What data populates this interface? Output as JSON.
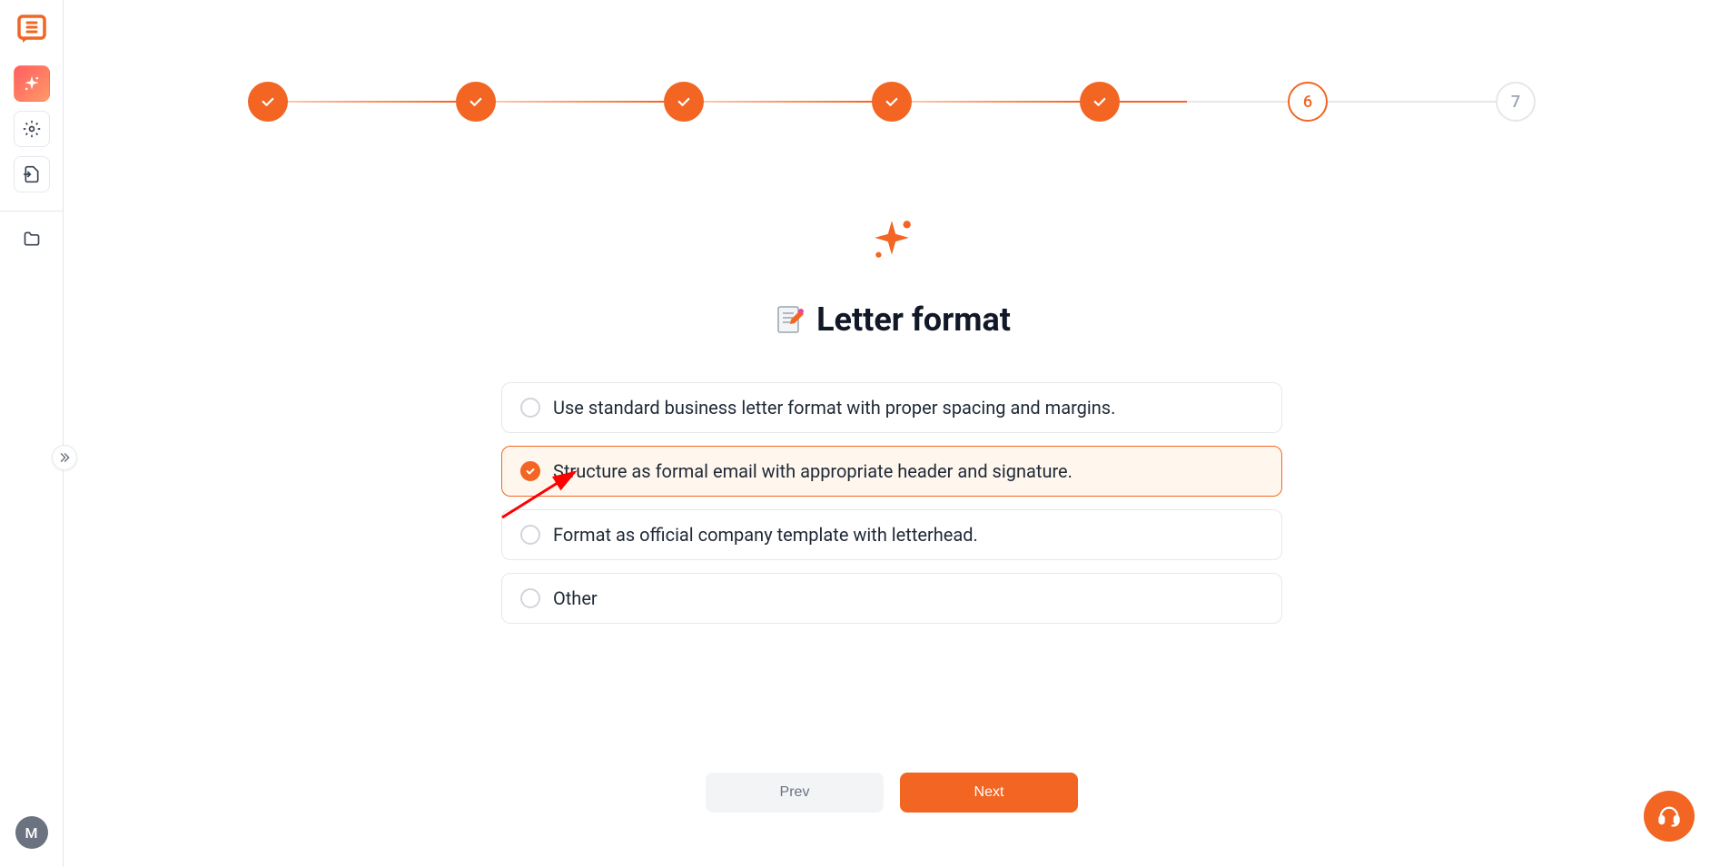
{
  "sidebar": {
    "avatar_letter": "M"
  },
  "stepper": {
    "steps": [
      {
        "status": "completed"
      },
      {
        "status": "completed"
      },
      {
        "status": "completed"
      },
      {
        "status": "completed"
      },
      {
        "status": "completed"
      },
      {
        "status": "current",
        "label": "6"
      },
      {
        "status": "pending",
        "label": "7"
      }
    ]
  },
  "page": {
    "title": "Letter format"
  },
  "options": {
    "items": [
      {
        "label": "Use standard business letter format with proper spacing and margins.",
        "selected": false
      },
      {
        "label": "Structure as formal email with appropriate header and signature.",
        "selected": true
      },
      {
        "label": "Format as official company template with letterhead.",
        "selected": false
      },
      {
        "label": "Other",
        "selected": false
      }
    ]
  },
  "nav": {
    "prev_label": "Prev",
    "next_label": "Next"
  }
}
